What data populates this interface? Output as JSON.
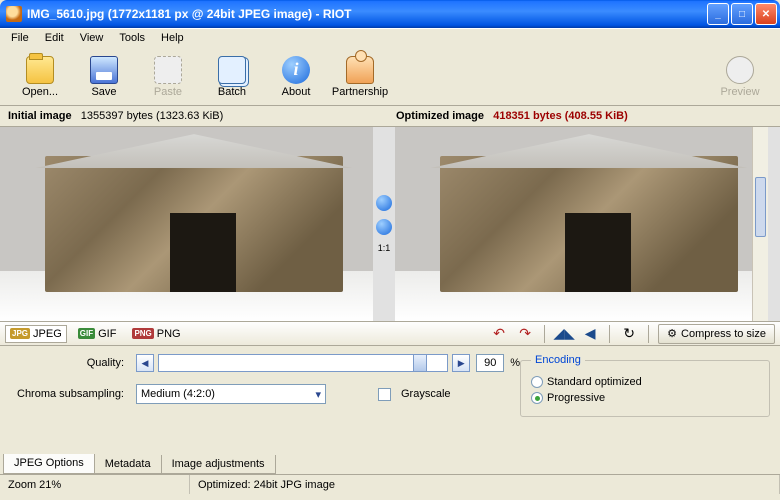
{
  "titlebar": {
    "title": "IMG_5610.jpg (1772x1181 px @ 24bit JPEG image) - RIOT"
  },
  "menu": {
    "items": [
      "File",
      "Edit",
      "View",
      "Tools",
      "Help"
    ]
  },
  "toolbar": {
    "open": "Open...",
    "save": "Save",
    "paste": "Paste",
    "batch": "Batch",
    "about": "About",
    "partnership": "Partnership",
    "preview": "Preview"
  },
  "stats": {
    "initial_label": "Initial image",
    "initial_value": "1355397 bytes (1323.63 KiB)",
    "optimized_label": "Optimized image",
    "optimized_value": "418351 bytes (408.55 KiB)"
  },
  "mid": {
    "ratio": "1:1"
  },
  "format_tabs": {
    "jpeg": "JPEG",
    "gif": "GIF",
    "png": "PNG"
  },
  "actions": {
    "compress": "Compress to size"
  },
  "settings": {
    "quality_label": "Quality:",
    "quality_value": "90",
    "quality_pct": "%",
    "chroma_label": "Chroma subsampling:",
    "chroma_value": "Medium (4:2:0)",
    "grayscale_label": "Grayscale",
    "encoding_legend": "Encoding",
    "encoding_standard": "Standard optimized",
    "encoding_progressive": "Progressive"
  },
  "bottom_tabs": {
    "jpeg_options": "JPEG Options",
    "metadata": "Metadata",
    "image_adjustments": "Image adjustments"
  },
  "statusbar": {
    "zoom": "Zoom 21%",
    "optimized": "Optimized: 24bit JPG image"
  }
}
